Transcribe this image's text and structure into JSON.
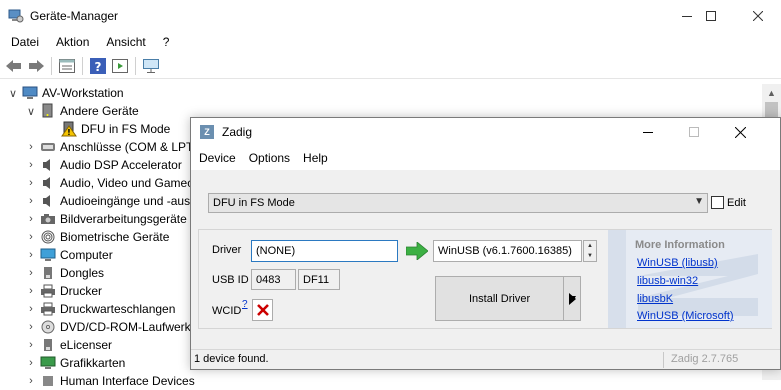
{
  "device_manager": {
    "title": "Geräte-Manager",
    "menu": [
      "Datei",
      "Aktion",
      "Ansicht",
      "?"
    ],
    "toolbar_icons": [
      "back-icon",
      "forward-icon",
      "properties-icon",
      "help-icon",
      "update-driver-icon",
      "monitor-icon"
    ],
    "tree": [
      {
        "label": "AV-Workstation",
        "chev": "∨",
        "icon": "computer-icon"
      },
      {
        "label": "Andere Geräte",
        "chev": "∨",
        "icon": "unknown-device-icon"
      },
      {
        "label": "DFU in FS Mode",
        "chev": "",
        "icon": "warning-device-icon"
      },
      {
        "label": "Anschlüsse (COM & LPT)",
        "chev": "›",
        "icon": "port-icon"
      },
      {
        "label": "Audio DSP Accelerator",
        "chev": "›",
        "icon": "audio-icon"
      },
      {
        "label": "Audio, Video und Gamecontroller",
        "chev": "›",
        "icon": "speaker-icon"
      },
      {
        "label": "Audioeingänge und -ausgänge",
        "chev": "›",
        "icon": "speaker-icon"
      },
      {
        "label": "Bildverarbeitungsgeräte",
        "chev": "›",
        "icon": "camera-icon"
      },
      {
        "label": "Biometrische Geräte",
        "chev": "›",
        "icon": "fingerprint-icon"
      },
      {
        "label": "Computer",
        "chev": "›",
        "icon": "monitor-icon"
      },
      {
        "label": "Dongles",
        "chev": "›",
        "icon": "dongle-icon"
      },
      {
        "label": "Drucker",
        "chev": "›",
        "icon": "printer-icon"
      },
      {
        "label": "Druckwarteschlangen",
        "chev": "›",
        "icon": "printer-icon"
      },
      {
        "label": "DVD/CD-ROM-Laufwerke",
        "chev": "›",
        "icon": "disc-icon"
      },
      {
        "label": "eLicenser",
        "chev": "›",
        "icon": "dongle-icon"
      },
      {
        "label": "Grafikkarten",
        "chev": "›",
        "icon": "display-adapter-icon"
      },
      {
        "label": "Human Interface Devices",
        "chev": "›",
        "icon": "hid-icon"
      }
    ]
  },
  "zadig": {
    "title": "Zadig",
    "menu": [
      "Device",
      "Options",
      "Help"
    ],
    "device_selected": "DFU in FS Mode",
    "edit_label": "Edit",
    "driver_label": "Driver",
    "driver_current": "(NONE)",
    "driver_target": "WinUSB (v6.1.7600.16385)",
    "usbid_label": "USB ID",
    "usbid_vid": "0483",
    "usbid_pid": "DF11",
    "wcid_label": "WCID",
    "wcid_help": "?",
    "install_label": "Install Driver",
    "info_heading": "More Information",
    "info_links": [
      "WinUSB (libusb)",
      "libusb-win32",
      "libusbK",
      "WinUSB (Microsoft)"
    ],
    "status": "1 device found.",
    "version": "Zadig 2.7.765",
    "colors": {
      "link": "#0033cc",
      "arrow": "#3cb043",
      "cross": "#cc0000",
      "info_bg": "#e6ebf3"
    }
  }
}
